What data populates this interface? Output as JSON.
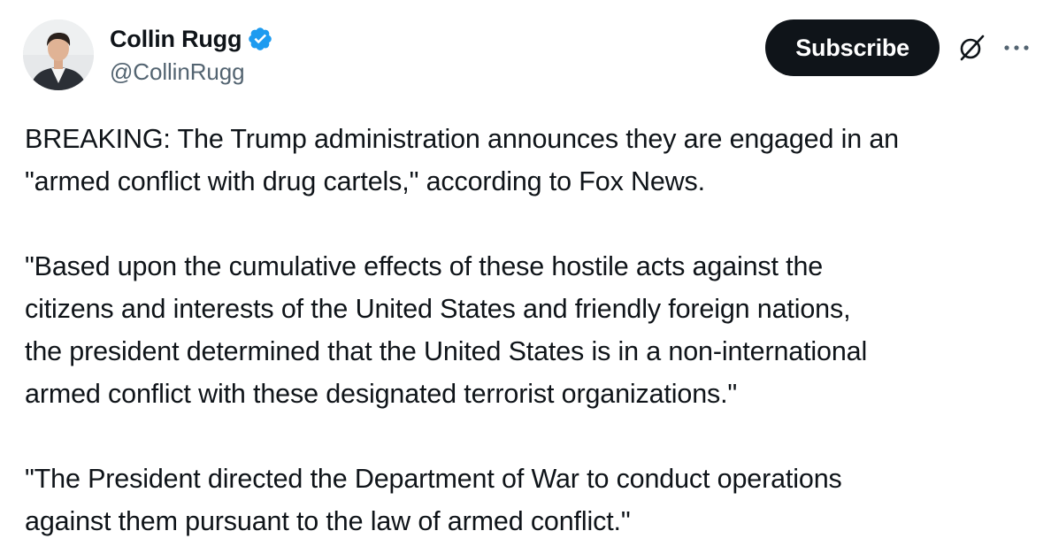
{
  "author": {
    "display_name": "Collin Rugg",
    "handle": "@CollinRugg",
    "verified": true,
    "verified_color": "#1d9bf0"
  },
  "actions": {
    "subscribe_label": "Subscribe",
    "grok_icon": "grok-icon",
    "more_icon": "more-dots-icon"
  },
  "tweet": {
    "paragraphs": [
      "BREAKING: The Trump administration announces they are engaged in an\n\"armed conflict with drug cartels,\" according to Fox News.",
      "\"Based upon the cumulative effects of these hostile acts against the\ncitizens and interests of the United States and friendly foreign nations,\nthe president determined that the United States is in a non-international\narmed conflict with these designated terrorist organizations.\"",
      "\"The President directed the Department of War to conduct operations\nagainst them pursuant to the law of armed conflict.\""
    ]
  }
}
